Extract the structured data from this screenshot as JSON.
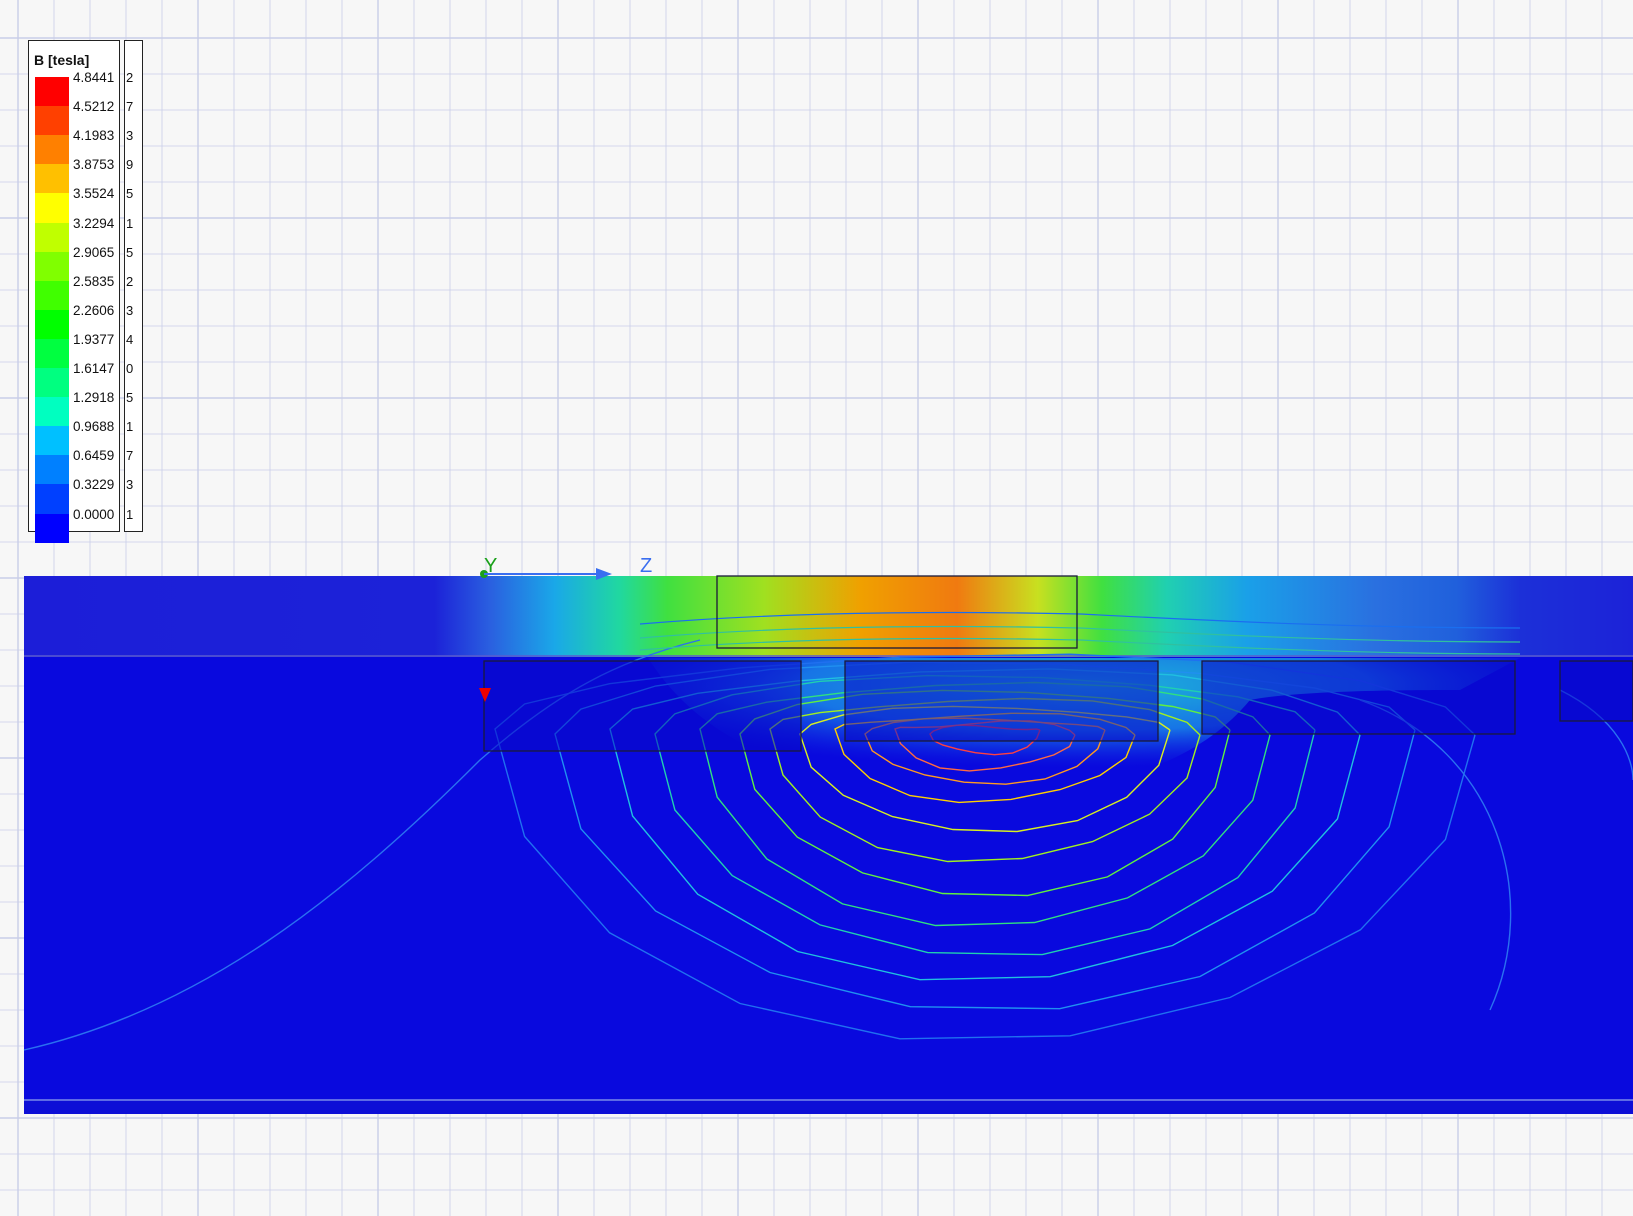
{
  "legend": {
    "title": "B [tesla]",
    "entries": [
      {
        "value": "4.8441",
        "color": "#ff0000"
      },
      {
        "value": "4.5212",
        "color": "#ff4000"
      },
      {
        "value": "4.1983",
        "color": "#ff8000"
      },
      {
        "value": "3.8753",
        "color": "#ffc000"
      },
      {
        "value": "3.5524",
        "color": "#ffff00"
      },
      {
        "value": "3.2294",
        "color": "#c0ff00"
      },
      {
        "value": "2.9065",
        "color": "#80ff00"
      },
      {
        "value": "2.5835",
        "color": "#40ff00"
      },
      {
        "value": "2.2606",
        "color": "#00ff00"
      },
      {
        "value": "1.9377",
        "color": "#00ff40"
      },
      {
        "value": "1.6147",
        "color": "#00ff80"
      },
      {
        "value": "1.2918",
        "color": "#00ffc0"
      },
      {
        "value": "0.9688",
        "color": "#00c0ff"
      },
      {
        "value": "0.6459",
        "color": "#0080ff"
      },
      {
        "value": "0.3229",
        "color": "#0040ff"
      },
      {
        "value": "0.0000",
        "color": "#0000ff"
      }
    ],
    "ghost_digits": [
      "2",
      "7",
      "3",
      "9",
      "5",
      "1",
      "5",
      "2",
      "3",
      "4",
      "0",
      "5",
      "1",
      "7",
      "3",
      "1"
    ]
  },
  "axes": {
    "y_label": "Y",
    "z_label": "Z",
    "y_color": "#1aa01a",
    "z_color": "#3a6ef0",
    "x_color": "#ee0000"
  },
  "colors": {
    "background": "#f7f7f7",
    "grid": "#c9cde8",
    "plot_base": "#0909de"
  }
}
